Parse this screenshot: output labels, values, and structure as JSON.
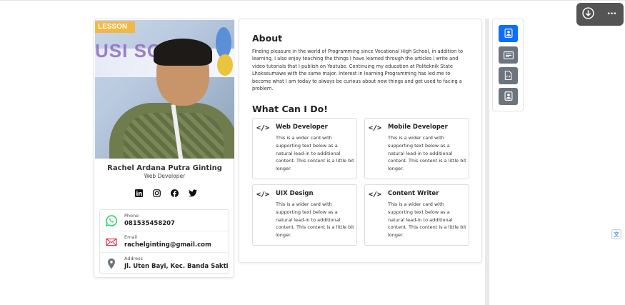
{
  "profile": {
    "name": "Rachel Ardana Putra Ginting",
    "role": "Web Developer",
    "photo_badge": "LESSON",
    "photo_banner": "USI SOSIAL",
    "socials": [
      "linkedin-icon",
      "instagram-icon",
      "facebook-icon",
      "twitter-icon"
    ],
    "contacts": [
      {
        "icon": "whatsapp-icon",
        "label": "Phone",
        "value": "081535458207",
        "color": "#25d366"
      },
      {
        "icon": "mail-icon",
        "label": "Email",
        "value": "rachelginting@gmail.com",
        "color": "#dc3545"
      },
      {
        "icon": "location-pin-icon",
        "label": "Address",
        "value": "Jl. Uten Bayi, Kec. Banda Sakti",
        "color": "#6c757d"
      }
    ]
  },
  "about": {
    "title": "About",
    "text": "Finding pleasure in the world of Programming since Vocational High School, in addition to learning, I also enjoy teaching the things I have learned through the articles I write and video tutorials that I publish on Youtube. Continuing my education at Politeknik State Lhokseumawe with the same major. Interest in learning Programming has led me to become what I am today to always be curious about new things and get used to facing a problem."
  },
  "services": {
    "title": "What Can I Do!",
    "items": [
      {
        "title": "Web Developer",
        "desc": "This is a wider card with supporting text below as a natural lead-in to additional content. This content is a little bit longer."
      },
      {
        "title": "Mobile Developer",
        "desc": "This is a wider card with supporting text below as a natural lead-in to additional content. This content is a little bit longer."
      },
      {
        "title": "UIX Design",
        "desc": "This is a wider card with supporting text below as a natural lead-in to additional content. This content is a little bit longer."
      },
      {
        "title": "Content Writer",
        "desc": "This is a wider card with supporting text below as a natural lead-in to additional content. This content is a little bit longer."
      }
    ],
    "icon_glyph": "</>"
  },
  "side_nav": {
    "items": [
      "profile-icon",
      "resume-icon",
      "code-file-icon",
      "portfolio-icon"
    ],
    "active_color": "#0d6efd",
    "inactive_color": "#6c757d"
  },
  "overlay": {
    "buttons": [
      "download-icon",
      "more-options-icon"
    ],
    "more_glyph": "•••"
  }
}
